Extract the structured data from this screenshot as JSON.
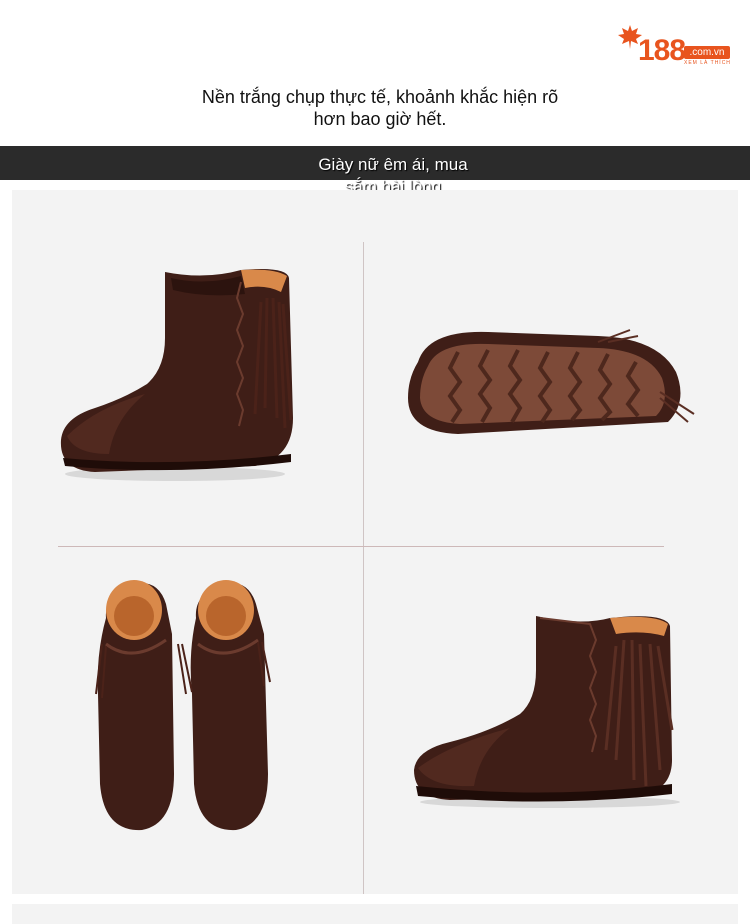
{
  "logo": {
    "number": "188",
    "domain": ".com.vn",
    "slogan": "XEM LÀ THÍCH"
  },
  "intro": {
    "line1": "Nền trắng chụp thực tế, khoảnh khắc hiện rõ",
    "line2": "hơn bao giờ hết."
  },
  "banner": {
    "line1": "Giày nữ êm ái, mua",
    "line2": "sắm hài lòng"
  },
  "gallery": {
    "images": [
      {
        "view": "side"
      },
      {
        "view": "sole"
      },
      {
        "view": "front-pair"
      },
      {
        "view": "side-reverse"
      }
    ]
  },
  "colors": {
    "brand": "#e8541e",
    "band": "#2b2b2b",
    "leather": "#3f1e17",
    "lining": "#d9894a"
  }
}
